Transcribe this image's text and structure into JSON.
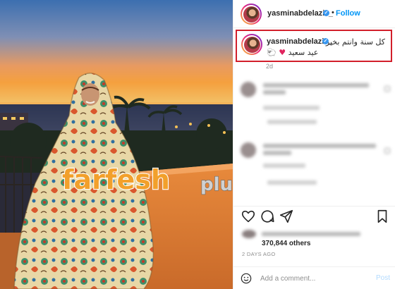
{
  "post": {
    "username": "yasminabdelaziz_",
    "follow_label": "Follow",
    "separator": "•",
    "verified_mark": "✓",
    "caption_line1": "كل سنة وانتم بخير",
    "caption_line2_text": "عيد سعيد",
    "caption_emoji_heart": "♥",
    "caption_emoji_sheep": "🐑",
    "time_ago": "2d",
    "likes_text": "370,844 others",
    "date": "2 DAYS AGO"
  },
  "composer": {
    "placeholder": "Add a comment...",
    "post_label": "Post"
  },
  "watermark": {
    "text_main": "farfesh",
    "text_tail": "plus.com"
  },
  "icons": [
    "verified-icon",
    "heart-icon",
    "comment-icon",
    "share-icon",
    "bookmark-icon",
    "emoji-icon"
  ],
  "colors": {
    "accent_blue": "#0095f6",
    "highlight_box": "#d21f2b",
    "watermark_fill": "#f2a02b"
  }
}
